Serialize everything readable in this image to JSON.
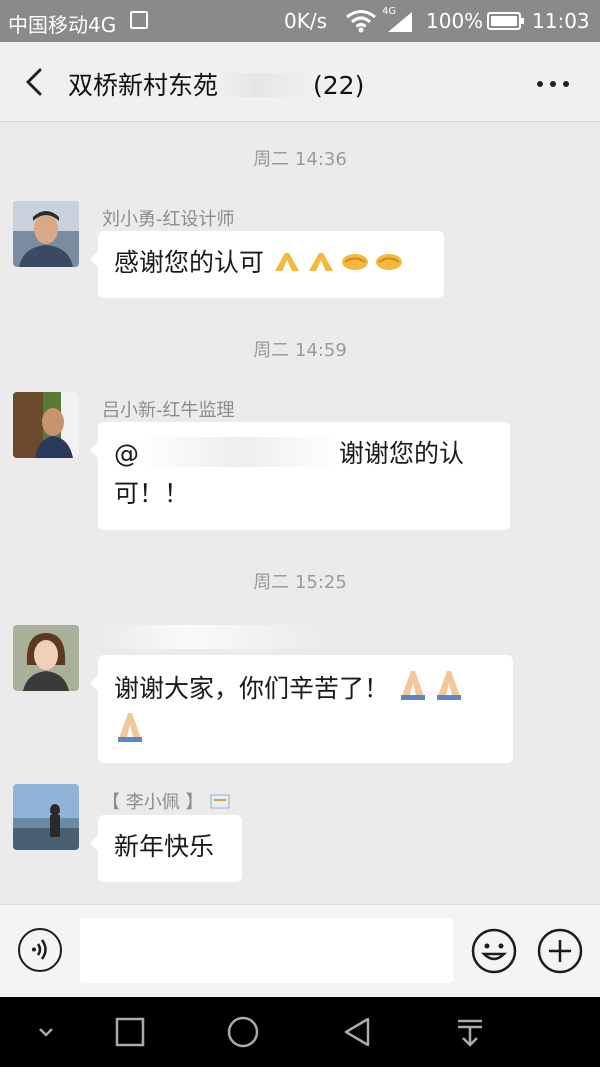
{
  "status_bar": {
    "carrier": "中国移动4G",
    "speed": "0K/s",
    "network": "4G",
    "battery": "100%",
    "time": "11:03"
  },
  "header": {
    "title": "双桥新村东苑",
    "member_count": "(22)"
  },
  "messages": [
    {
      "timestamp": "周二 14:36",
      "sender": "刘小勇-红设计师",
      "text": "感谢您的认可",
      "emoji": [
        "pray",
        "pray",
        "handshake",
        "handshake"
      ]
    },
    {
      "timestamp": "周二 14:59",
      "sender": "吕小新-红牛监理",
      "mention": "@",
      "text_line1": "谢谢您的认",
      "text_line2": "可！！"
    },
    {
      "timestamp": "周二 15:25",
      "sender": "",
      "text": "谢谢大家，你们辛苦了！",
      "emoji": [
        "folded-hands",
        "folded-hands",
        "folded-hands"
      ]
    },
    {
      "sender": "【 李小佩 】",
      "text": "新年快乐"
    }
  ],
  "input_bar": {
    "icons": [
      "voice-icon",
      "emoji-icon",
      "plus-icon"
    ],
    "placeholder": ""
  },
  "nav_bar": {
    "icons": [
      "collapse-icon",
      "recents-icon",
      "home-icon",
      "back-icon",
      "notification-pull-icon"
    ]
  },
  "colors": {
    "status_bar": "#8a8a8a",
    "header": "#f0f0f0",
    "chat_bg": "#ebebeb",
    "bubble": "#ffffff",
    "nav_bar": "#000000"
  }
}
